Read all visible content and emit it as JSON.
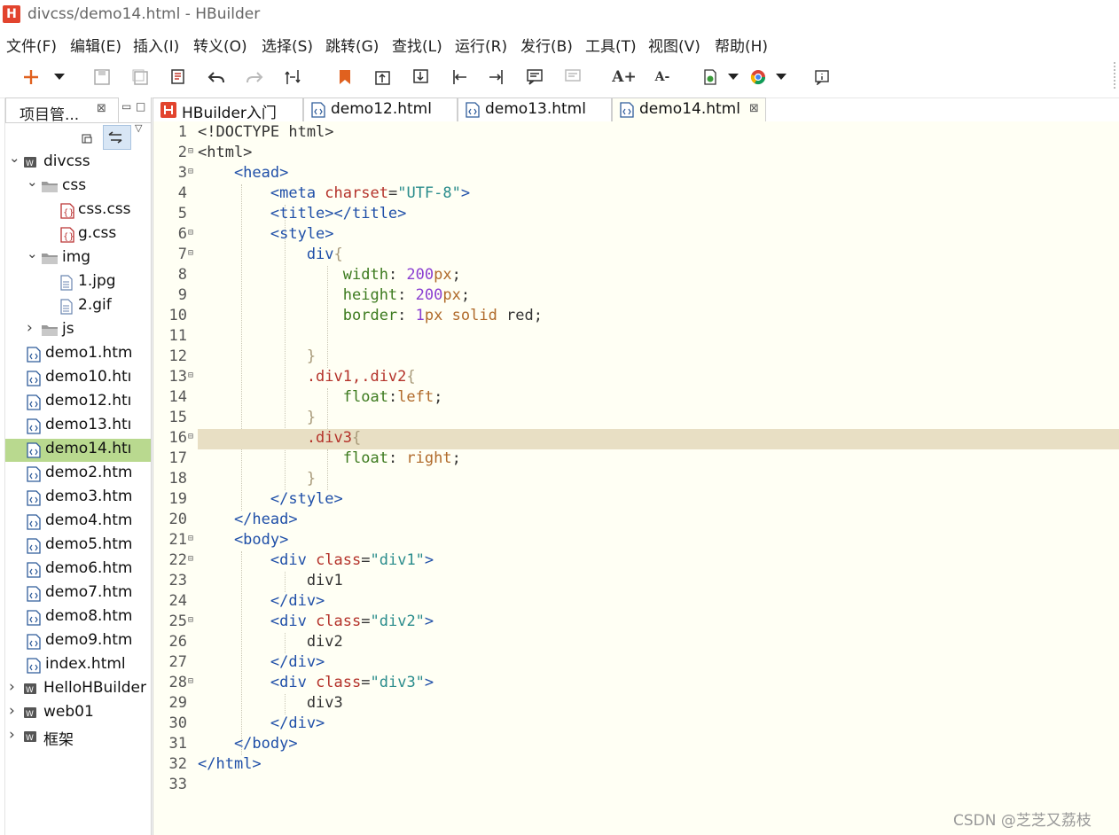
{
  "window": {
    "title": "divcss/demo14.html  -  HBuilder",
    "logo_letter": "H"
  },
  "menu": [
    "文件(F)",
    "编辑(E)",
    "插入(I)",
    "转义(O)",
    "选择(S)",
    "跳转(G)",
    "查找(L)",
    "运行(R)",
    "发行(B)",
    "工具(T)",
    "视图(V)",
    "帮助(H)"
  ],
  "toolbar": {
    "icons": [
      "new-icon",
      "new-dropdown-icon",
      "save-icon",
      "save-all-icon",
      "format-icon",
      "undo-icon",
      "redo-icon",
      "compare-icon",
      "bookmark-icon",
      "goto-top-icon",
      "goto-bottom-icon",
      "jump-start-icon",
      "jump-end-icon",
      "comment-icon",
      "uncomment-icon",
      "font-increase-icon",
      "font-decrease-icon",
      "run-icon",
      "run-dropdown-icon",
      "browser-icon",
      "browser-dropdown-icon",
      "info-icon"
    ],
    "font_increase_glyph": "A+",
    "font_decrease_glyph": "A-"
  },
  "project_panel": {
    "tab_label": "项目管...",
    "tab_close": "⊠",
    "tree": [
      {
        "label": "divcss",
        "type": "project",
        "expanded": true,
        "depth": 0
      },
      {
        "label": "css",
        "type": "folder",
        "expanded": true,
        "depth": 1
      },
      {
        "label": "css.css",
        "type": "css",
        "depth": 2
      },
      {
        "label": "g.css",
        "type": "css",
        "depth": 2
      },
      {
        "label": "img",
        "type": "folder",
        "expanded": true,
        "depth": 1
      },
      {
        "label": "1.jpg",
        "type": "file",
        "depth": 2
      },
      {
        "label": "2.gif",
        "type": "file",
        "depth": 2
      },
      {
        "label": "js",
        "type": "folder",
        "depth": 1
      },
      {
        "label": "demo1.htm",
        "type": "html",
        "depth": 1
      },
      {
        "label": "demo10.htı",
        "type": "html",
        "depth": 1
      },
      {
        "label": "demo12.htı",
        "type": "html",
        "depth": 1
      },
      {
        "label": "demo13.htı",
        "type": "html",
        "depth": 1
      },
      {
        "label": "demo14.htı",
        "type": "html",
        "depth": 1,
        "selected": true
      },
      {
        "label": "demo2.htm",
        "type": "html",
        "depth": 1
      },
      {
        "label": "demo3.htm",
        "type": "html",
        "depth": 1
      },
      {
        "label": "demo4.htm",
        "type": "html",
        "depth": 1
      },
      {
        "label": "demo5.htm",
        "type": "html",
        "depth": 1
      },
      {
        "label": "demo6.htm",
        "type": "html",
        "depth": 1
      },
      {
        "label": "demo7.htm",
        "type": "html",
        "depth": 1
      },
      {
        "label": "demo8.htm",
        "type": "html",
        "depth": 1
      },
      {
        "label": "demo9.htm",
        "type": "html",
        "depth": 1
      },
      {
        "label": "index.html",
        "type": "html",
        "depth": 1
      },
      {
        "label": "HelloHBuilder",
        "type": "project",
        "expanded": false,
        "depth": 0
      },
      {
        "label": "web01",
        "type": "project",
        "expanded": false,
        "depth": 0
      },
      {
        "label": "框架",
        "type": "project",
        "expanded": false,
        "depth": 0
      }
    ]
  },
  "editor_tabs": [
    {
      "label": "HBuilder入门",
      "icon": "hbuilder-icon",
      "active": false
    },
    {
      "label": "demo12.html",
      "icon": "html-file-icon",
      "active": false
    },
    {
      "label": "demo13.html",
      "icon": "html-file-icon",
      "active": false
    },
    {
      "label": "demo14.html",
      "icon": "html-file-icon",
      "active": true,
      "close": "⊠"
    }
  ],
  "editor": {
    "highlighted_line": 16,
    "lines": [
      {
        "n": "1",
        "fold": false,
        "segs": [
          [
            "<!DOCTYPE html>",
            "#333"
          ]
        ]
      },
      {
        "n": "2",
        "fold": true,
        "segs": [
          [
            "<html>",
            "#333"
          ]
        ]
      },
      {
        "n": "3",
        "fold": true,
        "segs": [
          [
            "    <head>",
            "#1f4fa8"
          ]
        ]
      },
      {
        "n": "4",
        "fold": false,
        "segs": [
          [
            "        <meta ",
            "#1f4fa8"
          ],
          [
            "charset",
            "#b4322a"
          ],
          [
            "=",
            "#333"
          ],
          [
            "\"UTF-8\"",
            "#2a8c8c"
          ],
          [
            ">",
            "#1f4fa8"
          ]
        ]
      },
      {
        "n": "5",
        "fold": false,
        "segs": [
          [
            "        <title></title>",
            "#1f4fa8"
          ]
        ]
      },
      {
        "n": "6",
        "fold": true,
        "segs": [
          [
            "        <style>",
            "#1f4fa8"
          ]
        ]
      },
      {
        "n": "7",
        "fold": true,
        "segs": [
          [
            "            div",
            "#1f4fa8"
          ],
          [
            "{",
            "#a89a7a"
          ]
        ]
      },
      {
        "n": "8",
        "fold": false,
        "segs": [
          [
            "                width",
            "#3c7a1e"
          ],
          [
            ": ",
            "#333"
          ],
          [
            "200",
            "#8b3fd1"
          ],
          [
            "px",
            "#b06a2a"
          ],
          [
            ";",
            "#333"
          ]
        ]
      },
      {
        "n": "9",
        "fold": false,
        "segs": [
          [
            "                height",
            "#3c7a1e"
          ],
          [
            ": ",
            "#333"
          ],
          [
            "200",
            "#8b3fd1"
          ],
          [
            "px",
            "#b06a2a"
          ],
          [
            ";",
            "#333"
          ]
        ]
      },
      {
        "n": "10",
        "fold": false,
        "segs": [
          [
            "                border",
            "#3c7a1e"
          ],
          [
            ": ",
            "#333"
          ],
          [
            "1",
            "#8b3fd1"
          ],
          [
            "px ",
            "#b06a2a"
          ],
          [
            "solid ",
            "#b06a2a"
          ],
          [
            "red",
            "#333"
          ],
          [
            ";",
            "#333"
          ]
        ]
      },
      {
        "n": "11",
        "fold": false,
        "segs": []
      },
      {
        "n": "12",
        "fold": false,
        "segs": [
          [
            "            }",
            "#a89a7a"
          ]
        ]
      },
      {
        "n": "13",
        "fold": true,
        "segs": [
          [
            "            .div1,.div2",
            "#b4322a"
          ],
          [
            "{",
            "#a89a7a"
          ]
        ]
      },
      {
        "n": "14",
        "fold": false,
        "segs": [
          [
            "                float",
            "#3c7a1e"
          ],
          [
            ":",
            "#333"
          ],
          [
            "left",
            "#b06a2a"
          ],
          [
            ";",
            "#333"
          ]
        ]
      },
      {
        "n": "15",
        "fold": false,
        "segs": [
          [
            "            }",
            "#a89a7a"
          ]
        ]
      },
      {
        "n": "16",
        "fold": true,
        "segs": [
          [
            "            .div3",
            "#b4322a"
          ],
          [
            "{",
            "#a89a7a"
          ]
        ]
      },
      {
        "n": "17",
        "fold": false,
        "segs": [
          [
            "                float",
            "#3c7a1e"
          ],
          [
            ": ",
            "#333"
          ],
          [
            "right",
            "#b06a2a"
          ],
          [
            ";",
            "#333"
          ]
        ]
      },
      {
        "n": "18",
        "fold": false,
        "segs": [
          [
            "            }",
            "#a89a7a"
          ]
        ]
      },
      {
        "n": "19",
        "fold": false,
        "segs": [
          [
            "        </style>",
            "#1f4fa8"
          ]
        ]
      },
      {
        "n": "20",
        "fold": false,
        "segs": [
          [
            "    </head>",
            "#1f4fa8"
          ]
        ]
      },
      {
        "n": "21",
        "fold": true,
        "segs": [
          [
            "    <body>",
            "#1f4fa8"
          ]
        ]
      },
      {
        "n": "22",
        "fold": true,
        "segs": [
          [
            "        <div ",
            "#1f4fa8"
          ],
          [
            "class",
            "#b4322a"
          ],
          [
            "=",
            "#333"
          ],
          [
            "\"div1\"",
            "#2a8c8c"
          ],
          [
            ">",
            "#1f4fa8"
          ]
        ]
      },
      {
        "n": "23",
        "fold": false,
        "segs": [
          [
            "            div1",
            "#333"
          ]
        ]
      },
      {
        "n": "24",
        "fold": false,
        "segs": [
          [
            "        </div>",
            "#1f4fa8"
          ]
        ]
      },
      {
        "n": "25",
        "fold": true,
        "segs": [
          [
            "        <div ",
            "#1f4fa8"
          ],
          [
            "class",
            "#b4322a"
          ],
          [
            "=",
            "#333"
          ],
          [
            "\"div2\"",
            "#2a8c8c"
          ],
          [
            ">",
            "#1f4fa8"
          ]
        ]
      },
      {
        "n": "26",
        "fold": false,
        "segs": [
          [
            "            div2",
            "#333"
          ]
        ]
      },
      {
        "n": "27",
        "fold": false,
        "segs": [
          [
            "        </div>",
            "#1f4fa8"
          ]
        ]
      },
      {
        "n": "28",
        "fold": true,
        "segs": [
          [
            "        <div ",
            "#1f4fa8"
          ],
          [
            "class",
            "#b4322a"
          ],
          [
            "=",
            "#333"
          ],
          [
            "\"div3\"",
            "#2a8c8c"
          ],
          [
            ">",
            "#1f4fa8"
          ]
        ]
      },
      {
        "n": "29",
        "fold": false,
        "segs": [
          [
            "            div3",
            "#333"
          ]
        ]
      },
      {
        "n": "30",
        "fold": false,
        "segs": [
          [
            "        </div>",
            "#1f4fa8"
          ]
        ]
      },
      {
        "n": "31",
        "fold": false,
        "segs": [
          [
            "    </body>",
            "#1f4fa8"
          ]
        ]
      },
      {
        "n": "32",
        "fold": false,
        "segs": [
          [
            "</html>",
            "#1f4fa8"
          ]
        ]
      },
      {
        "n": "33",
        "fold": false,
        "segs": []
      }
    ]
  },
  "watermark": "CSDN @芝芝又荔枝"
}
